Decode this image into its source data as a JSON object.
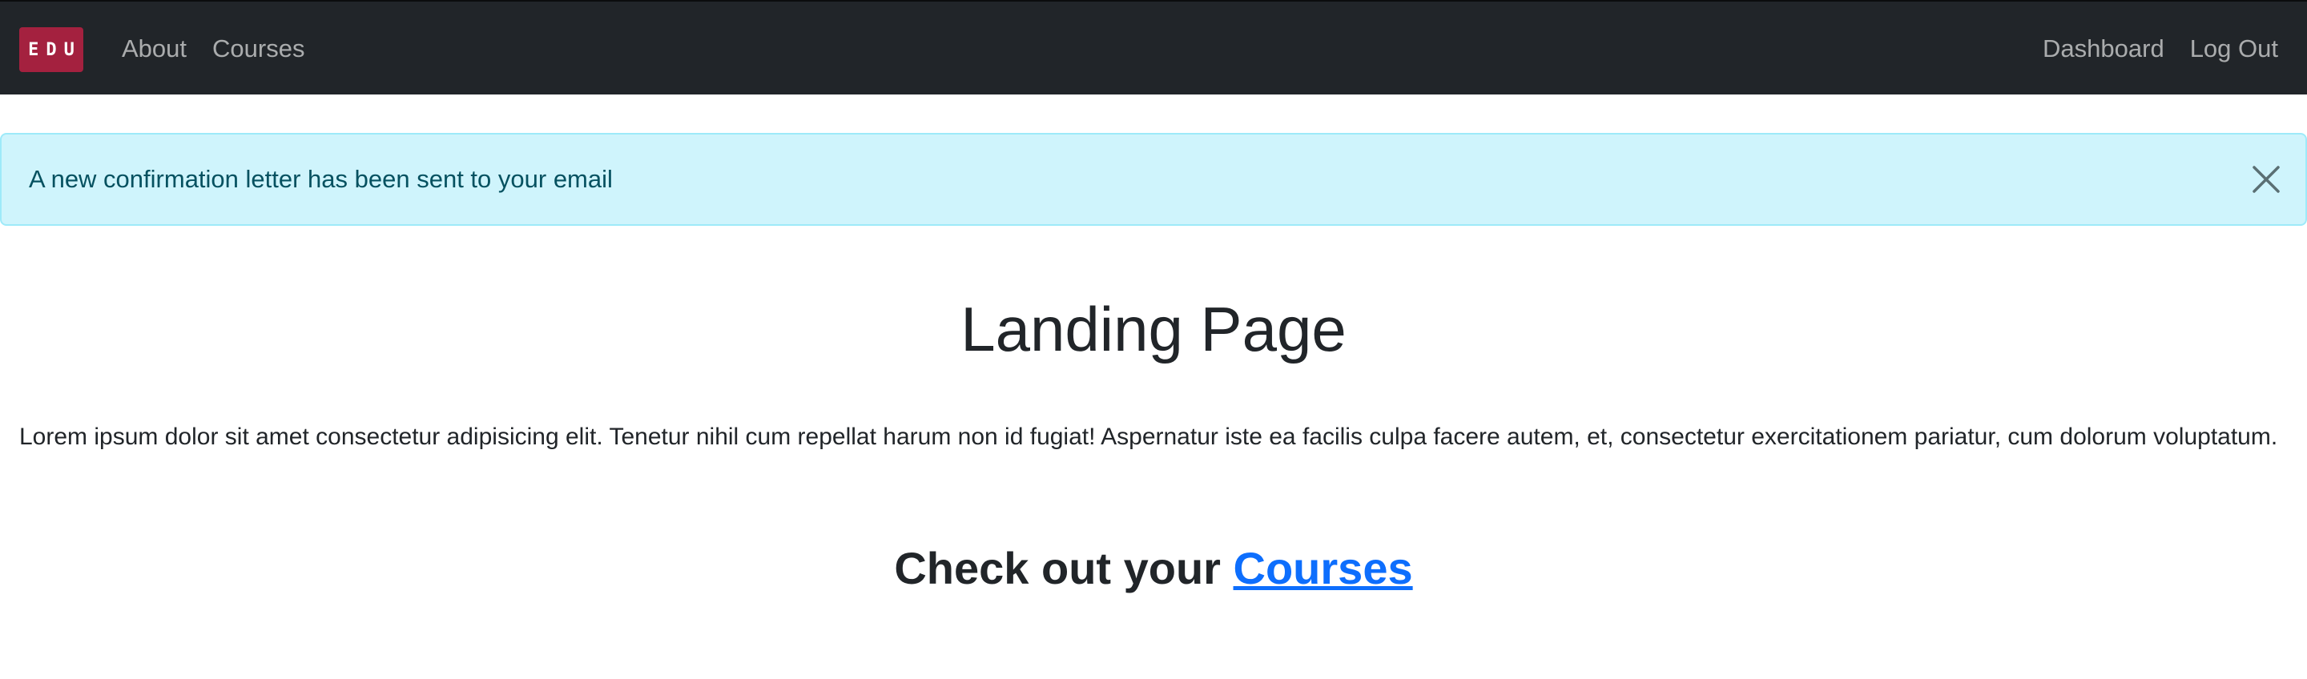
{
  "navbar": {
    "brand": "EDU",
    "left_links": [
      "About",
      "Courses"
    ],
    "right_links": [
      "Dashboard",
      "Log Out"
    ]
  },
  "alert": {
    "message": "A new confirmation letter has been sent to your email",
    "close_icon": "close-icon"
  },
  "main": {
    "title": "Landing Page",
    "paragraph": "Lorem ipsum dolor sit amet consectetur adipisicing elit. Tenetur nihil cum repellat harum non id fugiat! Aspernatur iste ea facilis culpa facere autem, et, consectetur exercitationem pariatur, cum dolorum voluptatum.",
    "cta_prefix": "Check out your ",
    "cta_link": "Courses"
  },
  "colors": {
    "navbar_bg": "#212529",
    "brand_bg": "#a4213f",
    "alert_bg": "#cff4fc",
    "alert_text": "#055160",
    "link": "#0d6efd"
  }
}
